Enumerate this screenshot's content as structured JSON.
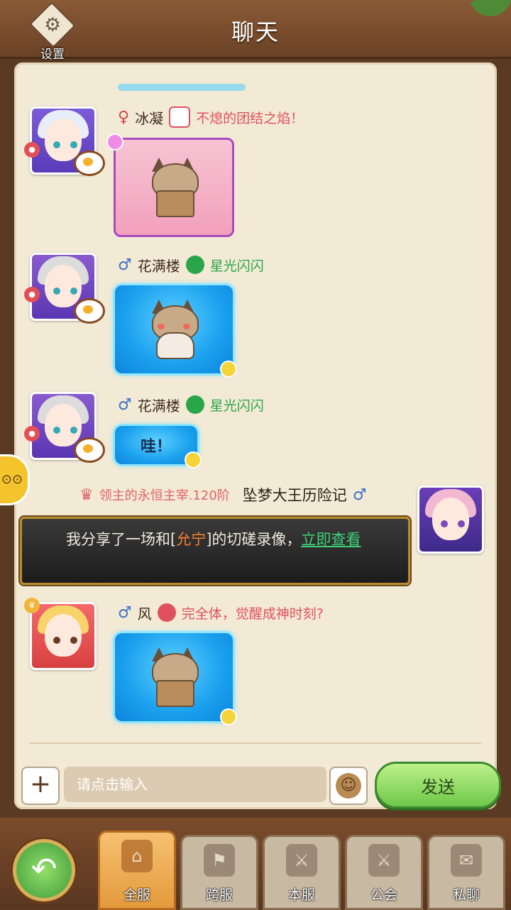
{
  "header": {
    "title": "聊天",
    "settings_label": "设置"
  },
  "messages": [
    {
      "sender": "冰凝",
      "gender": "♀",
      "guild": "不熄的团结之焰！",
      "kind": "sticker"
    },
    {
      "sender": "花满楼",
      "gender": "♂",
      "guild": "星光闪闪",
      "kind": "sticker"
    },
    {
      "sender": "花满楼",
      "gender": "♂",
      "guild": "星光闪闪",
      "text": "哇！"
    },
    {
      "sender": "坠梦大王历险记",
      "gender": "♂",
      "title": "领主的永恒主宰.120阶",
      "text_before": "我分享了一场和[",
      "highlight": "允宁",
      "text_after": "]的切磋录像，",
      "link": "立即查看"
    },
    {
      "sender": "风",
      "gender": "♂",
      "guild": "完全体，觉醒成神时刻?",
      "kind": "sticker"
    }
  ],
  "input": {
    "placeholder": "请点击输入",
    "send_label": "发送"
  },
  "tabs": [
    {
      "label": "全服",
      "active": true
    },
    {
      "label": "跨服",
      "active": false
    },
    {
      "label": "本服",
      "active": false
    },
    {
      "label": "公会",
      "active": false
    },
    {
      "label": "私聊",
      "active": false
    }
  ],
  "colors": {
    "male": "#3b72c4",
    "female": "#d5454d",
    "guild_green": "#2aa54a",
    "guild_pink": "#e0515d",
    "link": "#3ed178",
    "highlight": "#f7812e"
  }
}
